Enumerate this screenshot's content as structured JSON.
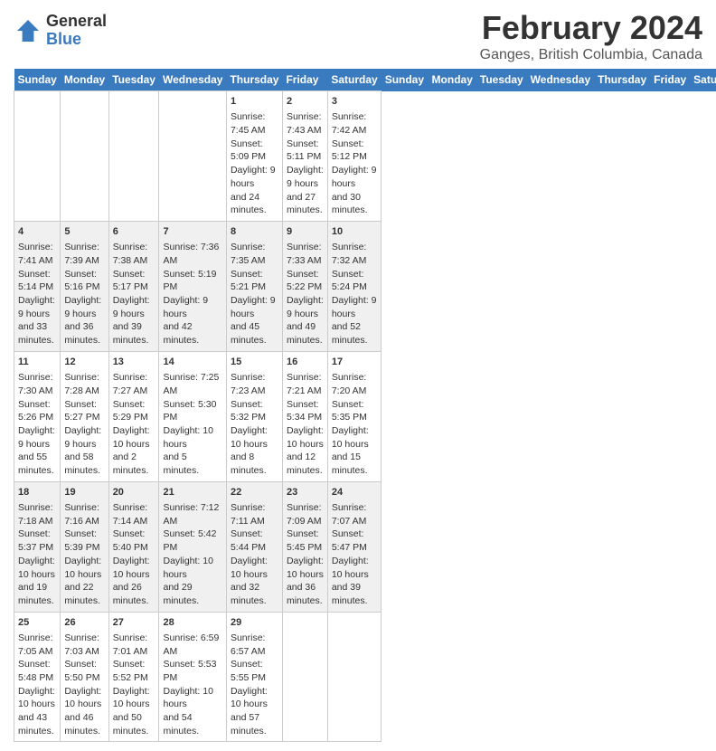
{
  "logo": {
    "line1": "General",
    "line2": "Blue"
  },
  "title": "February 2024",
  "subtitle": "Ganges, British Columbia, Canada",
  "days_of_week": [
    "Sunday",
    "Monday",
    "Tuesday",
    "Wednesday",
    "Thursday",
    "Friday",
    "Saturday"
  ],
  "weeks": [
    [
      {
        "day": "",
        "content": ""
      },
      {
        "day": "",
        "content": ""
      },
      {
        "day": "",
        "content": ""
      },
      {
        "day": "",
        "content": ""
      },
      {
        "day": "1",
        "content": "Sunrise: 7:45 AM\nSunset: 5:09 PM\nDaylight: 9 hours\nand 24 minutes."
      },
      {
        "day": "2",
        "content": "Sunrise: 7:43 AM\nSunset: 5:11 PM\nDaylight: 9 hours\nand 27 minutes."
      },
      {
        "day": "3",
        "content": "Sunrise: 7:42 AM\nSunset: 5:12 PM\nDaylight: 9 hours\nand 30 minutes."
      }
    ],
    [
      {
        "day": "4",
        "content": "Sunrise: 7:41 AM\nSunset: 5:14 PM\nDaylight: 9 hours\nand 33 minutes."
      },
      {
        "day": "5",
        "content": "Sunrise: 7:39 AM\nSunset: 5:16 PM\nDaylight: 9 hours\nand 36 minutes."
      },
      {
        "day": "6",
        "content": "Sunrise: 7:38 AM\nSunset: 5:17 PM\nDaylight: 9 hours\nand 39 minutes."
      },
      {
        "day": "7",
        "content": "Sunrise: 7:36 AM\nSunset: 5:19 PM\nDaylight: 9 hours\nand 42 minutes."
      },
      {
        "day": "8",
        "content": "Sunrise: 7:35 AM\nSunset: 5:21 PM\nDaylight: 9 hours\nand 45 minutes."
      },
      {
        "day": "9",
        "content": "Sunrise: 7:33 AM\nSunset: 5:22 PM\nDaylight: 9 hours\nand 49 minutes."
      },
      {
        "day": "10",
        "content": "Sunrise: 7:32 AM\nSunset: 5:24 PM\nDaylight: 9 hours\nand 52 minutes."
      }
    ],
    [
      {
        "day": "11",
        "content": "Sunrise: 7:30 AM\nSunset: 5:26 PM\nDaylight: 9 hours\nand 55 minutes."
      },
      {
        "day": "12",
        "content": "Sunrise: 7:28 AM\nSunset: 5:27 PM\nDaylight: 9 hours\nand 58 minutes."
      },
      {
        "day": "13",
        "content": "Sunrise: 7:27 AM\nSunset: 5:29 PM\nDaylight: 10 hours\nand 2 minutes."
      },
      {
        "day": "14",
        "content": "Sunrise: 7:25 AM\nSunset: 5:30 PM\nDaylight: 10 hours\nand 5 minutes."
      },
      {
        "day": "15",
        "content": "Sunrise: 7:23 AM\nSunset: 5:32 PM\nDaylight: 10 hours\nand 8 minutes."
      },
      {
        "day": "16",
        "content": "Sunrise: 7:21 AM\nSunset: 5:34 PM\nDaylight: 10 hours\nand 12 minutes."
      },
      {
        "day": "17",
        "content": "Sunrise: 7:20 AM\nSunset: 5:35 PM\nDaylight: 10 hours\nand 15 minutes."
      }
    ],
    [
      {
        "day": "18",
        "content": "Sunrise: 7:18 AM\nSunset: 5:37 PM\nDaylight: 10 hours\nand 19 minutes."
      },
      {
        "day": "19",
        "content": "Sunrise: 7:16 AM\nSunset: 5:39 PM\nDaylight: 10 hours\nand 22 minutes."
      },
      {
        "day": "20",
        "content": "Sunrise: 7:14 AM\nSunset: 5:40 PM\nDaylight: 10 hours\nand 26 minutes."
      },
      {
        "day": "21",
        "content": "Sunrise: 7:12 AM\nSunset: 5:42 PM\nDaylight: 10 hours\nand 29 minutes."
      },
      {
        "day": "22",
        "content": "Sunrise: 7:11 AM\nSunset: 5:44 PM\nDaylight: 10 hours\nand 32 minutes."
      },
      {
        "day": "23",
        "content": "Sunrise: 7:09 AM\nSunset: 5:45 PM\nDaylight: 10 hours\nand 36 minutes."
      },
      {
        "day": "24",
        "content": "Sunrise: 7:07 AM\nSunset: 5:47 PM\nDaylight: 10 hours\nand 39 minutes."
      }
    ],
    [
      {
        "day": "25",
        "content": "Sunrise: 7:05 AM\nSunset: 5:48 PM\nDaylight: 10 hours\nand 43 minutes."
      },
      {
        "day": "26",
        "content": "Sunrise: 7:03 AM\nSunset: 5:50 PM\nDaylight: 10 hours\nand 46 minutes."
      },
      {
        "day": "27",
        "content": "Sunrise: 7:01 AM\nSunset: 5:52 PM\nDaylight: 10 hours\nand 50 minutes."
      },
      {
        "day": "28",
        "content": "Sunrise: 6:59 AM\nSunset: 5:53 PM\nDaylight: 10 hours\nand 54 minutes."
      },
      {
        "day": "29",
        "content": "Sunrise: 6:57 AM\nSunset: 5:55 PM\nDaylight: 10 hours\nand 57 minutes."
      },
      {
        "day": "",
        "content": ""
      },
      {
        "day": "",
        "content": ""
      }
    ]
  ],
  "colors": {
    "header_bg": "#3a7abf",
    "row_even": "#f0f0f0",
    "row_odd": "#ffffff"
  }
}
